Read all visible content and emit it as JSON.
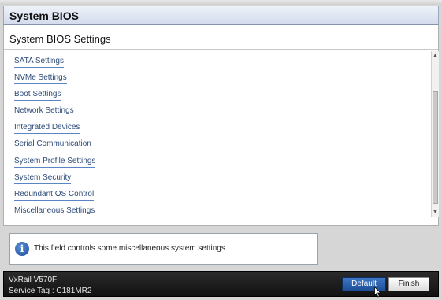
{
  "header": {
    "title": "System BIOS"
  },
  "section": {
    "title": "System BIOS Settings"
  },
  "menu": {
    "items": [
      {
        "label": "SATA Settings"
      },
      {
        "label": "NVMe Settings"
      },
      {
        "label": "Boot Settings"
      },
      {
        "label": "Network Settings"
      },
      {
        "label": "Integrated Devices"
      },
      {
        "label": "Serial Communication"
      },
      {
        "label": "System Profile Settings"
      },
      {
        "label": "System Security"
      },
      {
        "label": "Redundant OS Control"
      },
      {
        "label": "Miscellaneous Settings"
      }
    ]
  },
  "info": {
    "icon": "info-icon",
    "text": "This field controls some miscellaneous system settings."
  },
  "footer": {
    "model": "VxRail V570F",
    "service_tag": "Service Tag : C181MR2",
    "default_label": "Default",
    "finish_label": "Finish"
  },
  "colors": {
    "link": "#2d4a78",
    "link_underline": "#5b84c4",
    "primary_button": "#1d4f96",
    "footer_bg": "#111111"
  }
}
